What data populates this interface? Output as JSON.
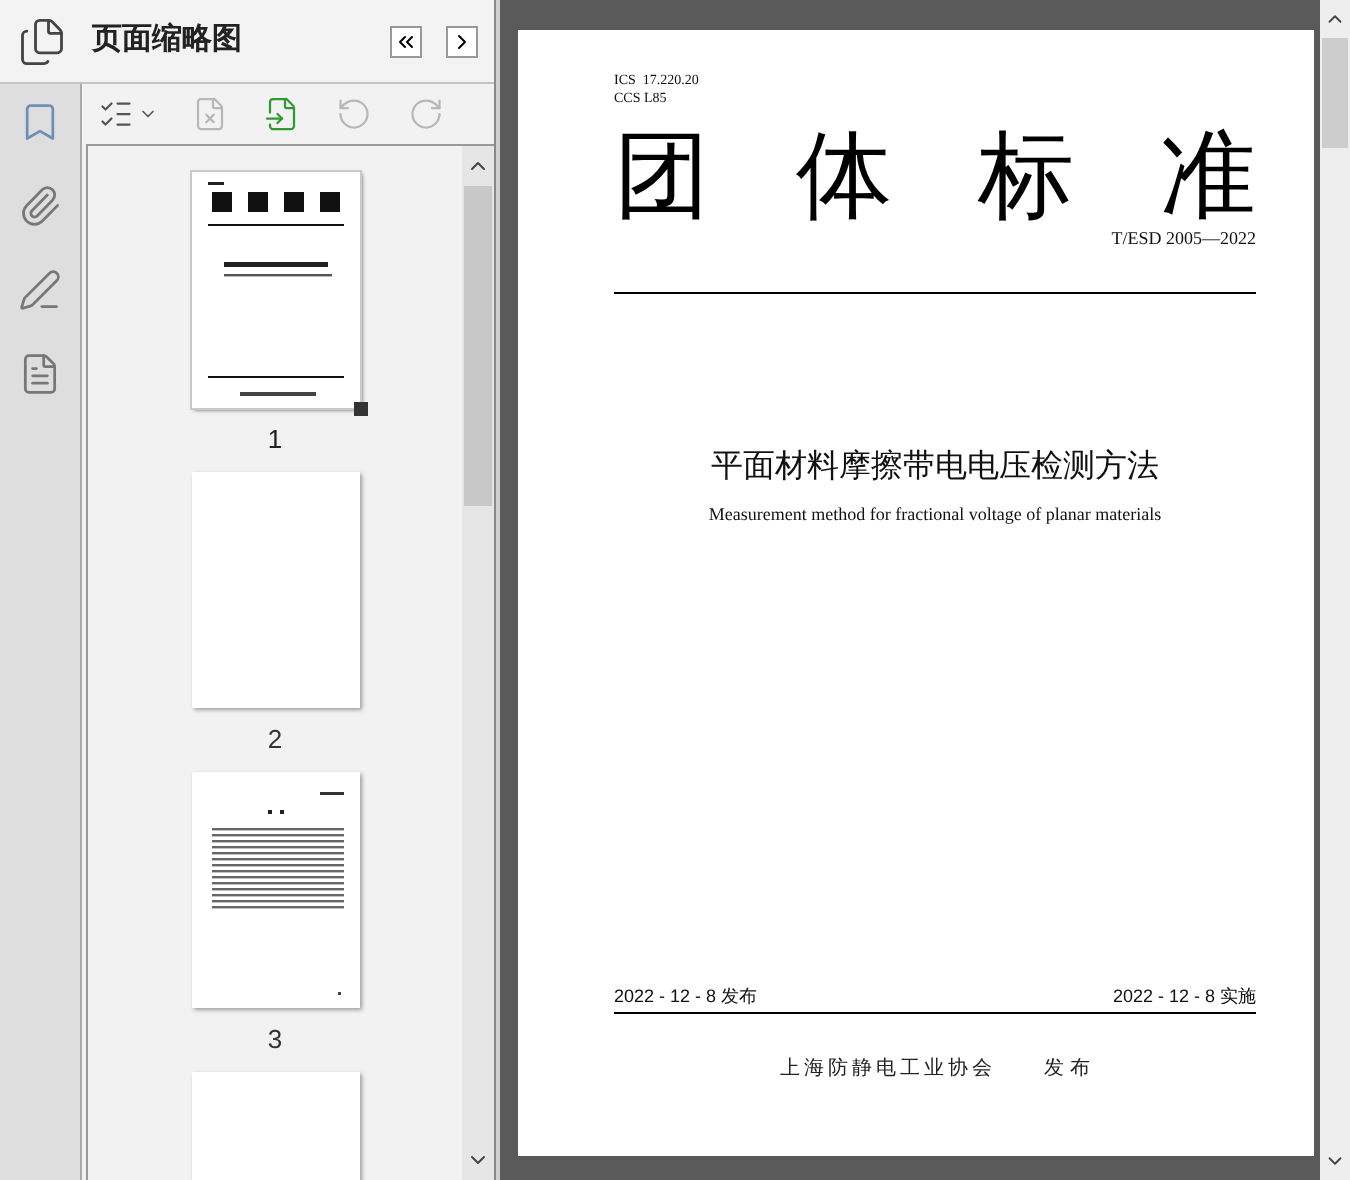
{
  "panel": {
    "title": "页面缩略图"
  },
  "toolbar": [
    {
      "kind": "options",
      "disabled": false
    },
    {
      "kind": "delete",
      "disabled": true
    },
    {
      "kind": "insert",
      "disabled": false
    },
    {
      "kind": "rotate-left",
      "disabled": true
    },
    {
      "kind": "rotate-right",
      "disabled": true
    }
  ],
  "thumbnails": [
    {
      "kind": "cover",
      "label": "1",
      "selected": true
    },
    {
      "kind": "blank",
      "label": "2",
      "selected": false
    },
    {
      "kind": "contents",
      "label": "3",
      "selected": false
    },
    {
      "kind": "blank",
      "selected": false
    }
  ],
  "document": {
    "ics": "ICS  17.220.20",
    "ccs": "CCS L85",
    "heading": "团 体 标 准",
    "number": "T/ESD 2005—2022",
    "title": "平面材料摩擦带电电压检测方法",
    "subtitle": "Measurement method for fractional voltage of planar materials",
    "issued": "2022 - 12 - 8 发布",
    "effective": "2022 - 12 - 8 实施",
    "publisher": "上海防静电工业协会",
    "publish_label": "发 布"
  }
}
